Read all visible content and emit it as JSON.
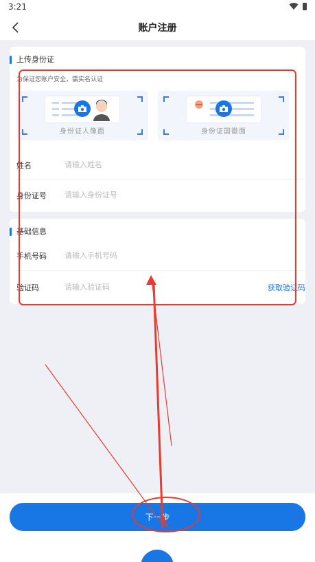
{
  "status_bar": {
    "time": "3:21",
    "wifi_icon": "wifi-icon",
    "battery_icon": "battery-icon"
  },
  "nav": {
    "back_icon": "back-chevron-icon",
    "title": "账户注册"
  },
  "id_section": {
    "title": "上传身份证",
    "hint": "为保证您账户安全，需实名认证",
    "front_caption": "身份证人像面",
    "back_caption": "身份证国徽面",
    "camera_icon": "camera-icon"
  },
  "fields": {
    "name": {
      "label": "姓名",
      "placeholder": "请输入姓名",
      "value": ""
    },
    "id_number": {
      "label": "身份证号",
      "placeholder": "请输入身份证号",
      "value": ""
    }
  },
  "basic_section": {
    "title": "基础信息",
    "phone": {
      "label": "手机号码",
      "placeholder": "请输入手机号码",
      "value": ""
    },
    "code": {
      "label": "验证码",
      "placeholder": "请输入验证码",
      "value": "",
      "get_code": "获取验证码"
    }
  },
  "actions": {
    "next": "下一步"
  },
  "colors": {
    "accent": "#1877e5",
    "annotation": "#e63b2e",
    "background": "#eef0f6"
  }
}
